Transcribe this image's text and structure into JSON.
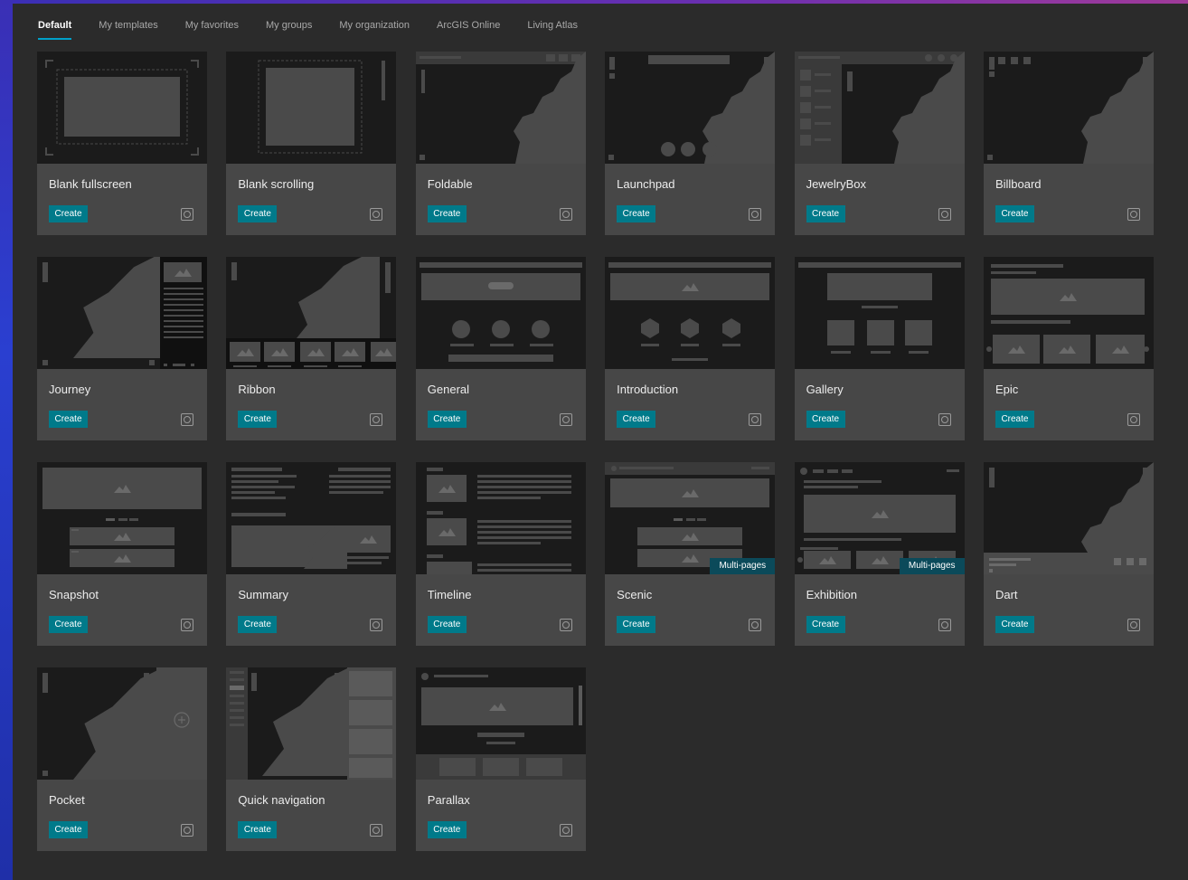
{
  "tabs": [
    {
      "label": "Default",
      "active": true
    },
    {
      "label": "My templates",
      "active": false
    },
    {
      "label": "My favorites",
      "active": false
    },
    {
      "label": "My groups",
      "active": false
    },
    {
      "label": "My organization",
      "active": false
    },
    {
      "label": "ArcGIS Online",
      "active": false
    },
    {
      "label": "Living Atlas",
      "active": false
    }
  ],
  "create_label": "Create",
  "badge_label": "Multi-pages",
  "colors": {
    "accent": "#007a8a",
    "tab_underline": "#00a0c8",
    "card_bg": "#474747",
    "thumb_bg": "#1b1b1b",
    "page_bg": "#2b2b2b"
  },
  "templates": [
    {
      "name": "Blank fullscreen",
      "thumb": "blank-fullscreen",
      "multipage": false
    },
    {
      "name": "Blank scrolling",
      "thumb": "blank-scrolling",
      "multipage": false
    },
    {
      "name": "Foldable",
      "thumb": "foldable",
      "multipage": false
    },
    {
      "name": "Launchpad",
      "thumb": "launchpad",
      "multipage": false
    },
    {
      "name": "JewelryBox",
      "thumb": "jewelrybox",
      "multipage": false
    },
    {
      "name": "Billboard",
      "thumb": "billboard",
      "multipage": false
    },
    {
      "name": "Journey",
      "thumb": "journey",
      "multipage": false
    },
    {
      "name": "Ribbon",
      "thumb": "ribbon",
      "multipage": false
    },
    {
      "name": "General",
      "thumb": "general",
      "multipage": false
    },
    {
      "name": "Introduction",
      "thumb": "introduction",
      "multipage": false
    },
    {
      "name": "Gallery",
      "thumb": "gallery",
      "multipage": false
    },
    {
      "name": "Epic",
      "thumb": "epic",
      "multipage": false
    },
    {
      "name": "Snapshot",
      "thumb": "snapshot",
      "multipage": false
    },
    {
      "name": "Summary",
      "thumb": "summary",
      "multipage": false
    },
    {
      "name": "Timeline",
      "thumb": "timeline",
      "multipage": false
    },
    {
      "name": "Scenic",
      "thumb": "scenic",
      "multipage": true
    },
    {
      "name": "Exhibition",
      "thumb": "exhibition",
      "multipage": true
    },
    {
      "name": "Dart",
      "thumb": "dart",
      "multipage": false
    },
    {
      "name": "Pocket",
      "thumb": "pocket",
      "multipage": false
    },
    {
      "name": "Quick navigation",
      "thumb": "quick-navigation",
      "multipage": false
    },
    {
      "name": "Parallax",
      "thumb": "parallax",
      "multipage": false
    }
  ]
}
